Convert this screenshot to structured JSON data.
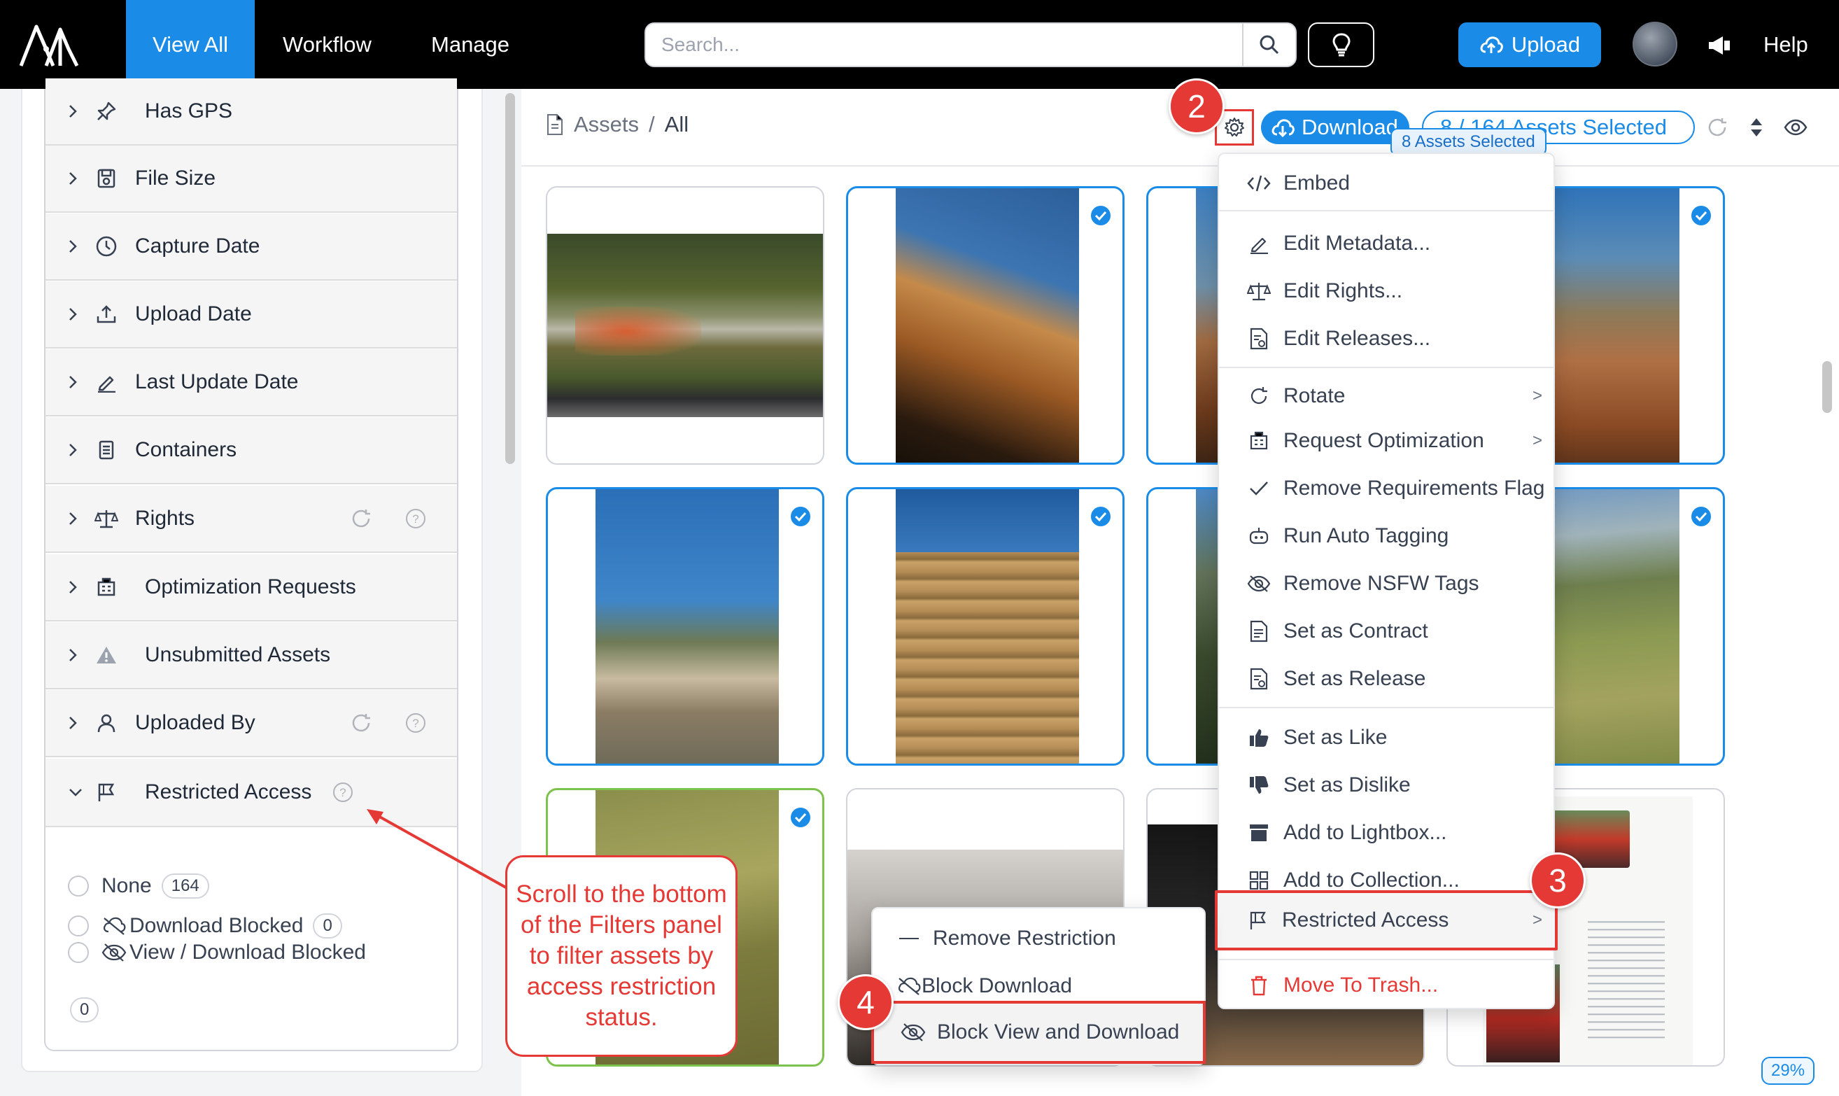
{
  "topbar": {
    "nav": [
      "View All",
      "Workflow",
      "Manage"
    ],
    "search_placeholder": "Search...",
    "upload_label": "Upload",
    "help_label": "Help"
  },
  "filters": {
    "rows": [
      {
        "label": "Has GPS",
        "icon": "pin-icon"
      },
      {
        "label": "File Size",
        "icon": "file-size-icon"
      },
      {
        "label": "Capture Date",
        "icon": "clock-icon"
      },
      {
        "label": "Upload Date",
        "icon": "upload-tray-icon"
      },
      {
        "label": "Last Update Date",
        "icon": "pencil-icon"
      },
      {
        "label": "Containers",
        "icon": "container-icon"
      },
      {
        "label": "Rights",
        "icon": "scales-icon"
      },
      {
        "label": "Optimization Requests",
        "icon": "optimization-icon"
      },
      {
        "label": "Unsubmitted Assets",
        "icon": "warning-icon"
      },
      {
        "label": "Uploaded By",
        "icon": "user-icon"
      },
      {
        "label": "Restricted Access",
        "icon": "flag-icon"
      }
    ],
    "restricted_options": [
      {
        "label": "None",
        "count": "164"
      },
      {
        "label": "Download Blocked",
        "count": "0"
      },
      {
        "label": "View / Download Blocked",
        "count": ""
      }
    ],
    "bottom_count": "0"
  },
  "main": {
    "breadcrumb_root": "Assets",
    "breadcrumb_sep": "/",
    "breadcrumb_current": "All",
    "download_label": "Download",
    "selection_text": "8 / 164 Assets Selected",
    "selected_badge": "8 Assets Selected",
    "zoom": "29%"
  },
  "menu": {
    "items": [
      {
        "label": "Embed",
        "icon": "code-icon"
      },
      {
        "label": "Edit Metadata...",
        "icon": "pencil-icon"
      },
      {
        "label": "Edit Rights...",
        "icon": "scales-icon"
      },
      {
        "label": "Edit Releases...",
        "icon": "release-doc-icon"
      },
      {
        "label": "Rotate",
        "icon": "rotate-icon"
      },
      {
        "label": "Request Optimization",
        "icon": "optimization-icon"
      },
      {
        "label": "Remove Requirements Flag",
        "icon": "checkmark-icon"
      },
      {
        "label": "Run Auto Tagging",
        "icon": "robot-icon"
      },
      {
        "label": "Remove NSFW Tags",
        "icon": "eye-slash-icon"
      },
      {
        "label": "Set as Contract",
        "icon": "contract-doc-icon"
      },
      {
        "label": "Set as Release",
        "icon": "release-doc-icon"
      },
      {
        "label": "Set as Like",
        "icon": "thumbs-up-icon"
      },
      {
        "label": "Set as Dislike",
        "icon": "thumbs-down-icon"
      },
      {
        "label": "Add to Lightbox...",
        "icon": "lightbox-icon"
      },
      {
        "label": "Add to Collection...",
        "icon": "collection-icon"
      },
      {
        "label": "Restricted Access",
        "icon": "flag-icon"
      },
      {
        "label": "Move To Trash...",
        "icon": "trash-icon"
      }
    ]
  },
  "submenu": {
    "items": [
      {
        "label": "Remove Restriction"
      },
      {
        "label": "Block Download"
      },
      {
        "label": "Block View and Download"
      }
    ]
  },
  "callouts": {
    "step2": "2",
    "step3": "3",
    "step4": "4",
    "note": "Scroll to the bottom of the Filters panel to filter assets by access restriction status."
  },
  "colors": {
    "accent": "#1a8ce8",
    "callout": "#e53935",
    "topbar": "#000000"
  }
}
